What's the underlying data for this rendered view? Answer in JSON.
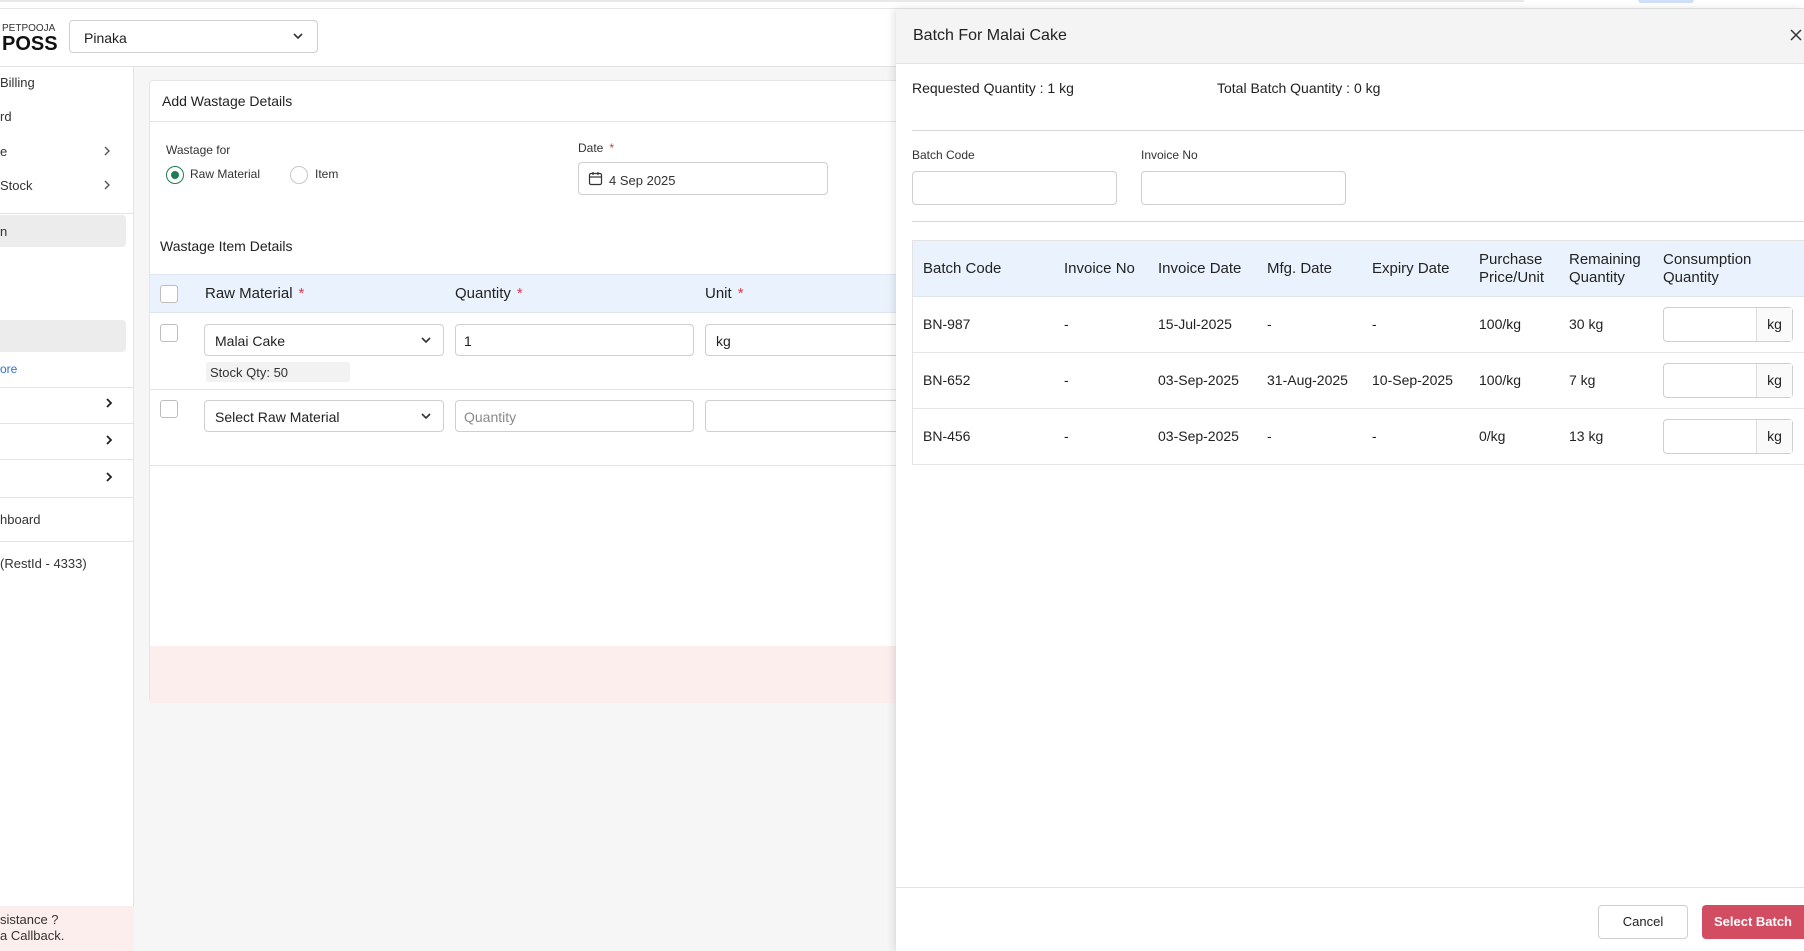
{
  "header": {
    "logo_small": "PETPOOJA",
    "logo_big": "POSS",
    "outlet": "Pinaka"
  },
  "sidebar": {
    "items": [
      {
        "label": "Billing"
      },
      {
        "label": "rd"
      },
      {
        "label": "e"
      },
      {
        "label": "Stock"
      },
      {
        "label": "n"
      },
      {
        "label": "ore"
      },
      {
        "label": "hboard"
      },
      {
        "label": "(RestId - 4333)"
      }
    ],
    "assist_line1": "sistance ?",
    "assist_line2": "a Callback."
  },
  "form": {
    "title": "Add Wastage Details",
    "wastage_for_label": "Wastage for",
    "radio_raw": "Raw Material",
    "radio_item": "Item",
    "date_label": "Date",
    "date_value": "4 Sep 2025",
    "section_title": "Wastage Item Details",
    "col_raw": "Raw Material",
    "col_qty": "Quantity",
    "col_unit": "Unit",
    "required_mark": "*",
    "rows": [
      {
        "material": "Malai Cake",
        "quantity": "1",
        "unit": "kg",
        "stock": "Stock Qty: 50"
      },
      {
        "material": "Select Raw Material",
        "quantity_placeholder": "Quantity"
      }
    ]
  },
  "drawer": {
    "title": "Batch For Malai Cake",
    "requested": "Requested Quantity : 1 kg",
    "total_batch": "Total Batch Quantity : 0 kg",
    "filter_batch_label": "Batch Code",
    "filter_invoice_label": "Invoice No",
    "columns": {
      "batch_code": "Batch Code",
      "invoice_no": "Invoice No",
      "invoice_date": "Invoice Date",
      "mfg_date": "Mfg. Date",
      "expiry_date": "Expiry Date",
      "price_l1": "Purchase",
      "price_l2": "Price/Unit",
      "remaining_l1": "Remaining",
      "remaining_l2": "Quantity",
      "consumption_l1": "Consumption",
      "consumption_l2": "Quantity"
    },
    "rows": [
      {
        "batch": "BN-987",
        "invoice": "-",
        "invoice_date": "15-Jul-2025",
        "mfg": "-",
        "expiry": "-",
        "price": "100/kg",
        "remaining": "30 kg",
        "unit": "kg"
      },
      {
        "batch": "BN-652",
        "invoice": "-",
        "invoice_date": "03-Sep-2025",
        "mfg": "31-Aug-2025",
        "expiry": "10-Sep-2025",
        "price": "100/kg",
        "remaining": "7 kg",
        "unit": "kg"
      },
      {
        "batch": "BN-456",
        "invoice": "-",
        "invoice_date": "03-Sep-2025",
        "mfg": "-",
        "expiry": "-",
        "price": "0/kg",
        "remaining": "13 kg",
        "unit": "kg"
      }
    ],
    "cancel": "Cancel",
    "select": "Select Batch"
  },
  "colors": {
    "accent_green": "#1f7d52",
    "primary_red": "#d34d62",
    "table_head": "#eaf3fd"
  }
}
